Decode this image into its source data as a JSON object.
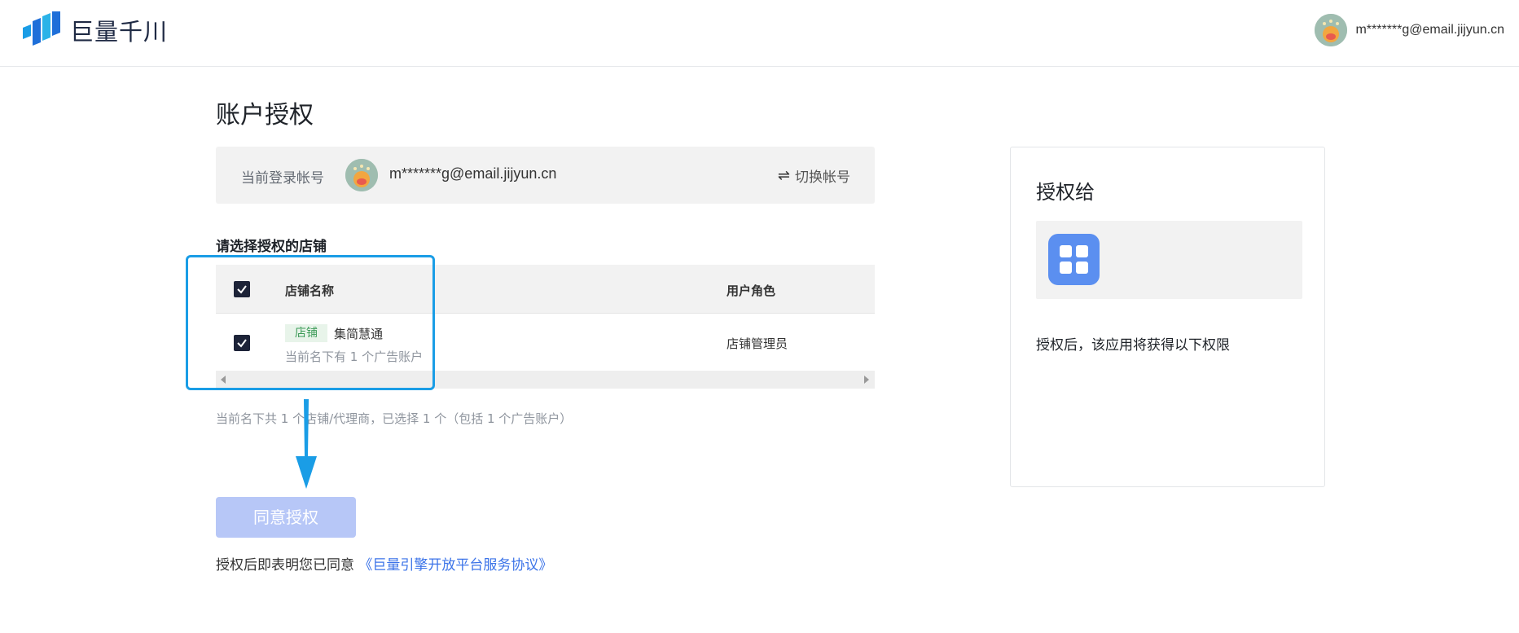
{
  "header": {
    "brand": "巨量千川",
    "user_email": "m*******g@email.jijyun.cn"
  },
  "main": {
    "title": "账户授权",
    "current_account": {
      "label": "当前登录帐号",
      "email": "m*******g@email.jijyun.cn",
      "switch_label": "切换帐号"
    },
    "store_section_label": "请选择授权的店铺",
    "table": {
      "columns": [
        "店铺名称",
        "用户角色"
      ],
      "all_checked": true,
      "rows": [
        {
          "checked": true,
          "tag": "店铺",
          "name": "集简慧通",
          "sub": "当前名下有 1 个广告账户",
          "role": "店铺管理员"
        }
      ]
    },
    "summary": "当前名下共 1 个店铺/代理商，已选择 1 个（包括 1 个广告账户）",
    "agree_button": "同意授权",
    "agreement_prefix": "授权后即表明您已同意",
    "agreement_link": "《巨量引擎开放平台服务协议》"
  },
  "auth_panel": {
    "title": "授权给",
    "permission_text": "授权后，该应用将获得以下权限"
  },
  "colors": {
    "accent_blue": "#1a9de6",
    "button_disabled": "#b7c7f7",
    "link": "#3b73e8",
    "tag_green": "#3a9a56",
    "checkbox": "#1d2338",
    "app_icon": "#5b8ff0"
  },
  "icons": {
    "logo": "juliang-qianchuan-logo",
    "switch": "swap-arrows-icon",
    "checkbox": "check-icon",
    "app": "grid-app-icon",
    "arrow": "down-arrow-annotation"
  }
}
